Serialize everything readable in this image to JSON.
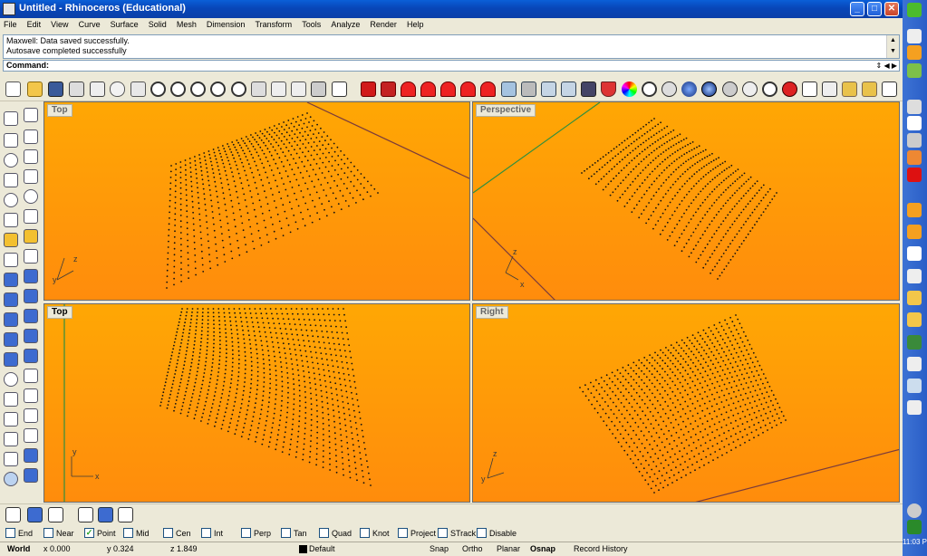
{
  "window": {
    "title": "Untitled - Rhinoceros (Educational)"
  },
  "menu": [
    "File",
    "Edit",
    "View",
    "Curve",
    "Surface",
    "Solid",
    "Mesh",
    "Dimension",
    "Transform",
    "Tools",
    "Analyze",
    "Render",
    "Help"
  ],
  "command": {
    "history": [
      "Maxwell: Data saved successfully.",
      "Autosave completed successfully"
    ],
    "prompt": "Command:"
  },
  "viewports": [
    {
      "label": "Top",
      "active": false
    },
    {
      "label": "Perspective",
      "active": false
    },
    {
      "label": "Top",
      "active": true
    },
    {
      "label": "Right",
      "active": false
    }
  ],
  "osnap": [
    {
      "label": "End",
      "checked": false
    },
    {
      "label": "Near",
      "checked": false
    },
    {
      "label": "Point",
      "checked": true
    },
    {
      "label": "Mid",
      "checked": false
    },
    {
      "label": "Cen",
      "checked": false
    },
    {
      "label": "Int",
      "checked": false
    },
    {
      "label": "Perp",
      "checked": false
    },
    {
      "label": "Tan",
      "checked": false
    },
    {
      "label": "Quad",
      "checked": false
    },
    {
      "label": "Knot",
      "checked": false
    },
    {
      "label": "Project",
      "checked": false
    },
    {
      "label": "STrack",
      "checked": false
    },
    {
      "label": "Disable",
      "checked": false
    }
  ],
  "status": {
    "cplane": "World",
    "x": "x 0.000",
    "y": "y 0.324",
    "z": "z 1.849",
    "layer": "Default",
    "toggles": [
      "Snap",
      "Ortho",
      "Planar",
      "Osnap",
      "Record History"
    ]
  },
  "clock": "11:03 P",
  "colors": {
    "viewport_top": "#ffa704",
    "viewport_bottom": "#ff8c0c",
    "titlebar": "#0a4fc8"
  }
}
